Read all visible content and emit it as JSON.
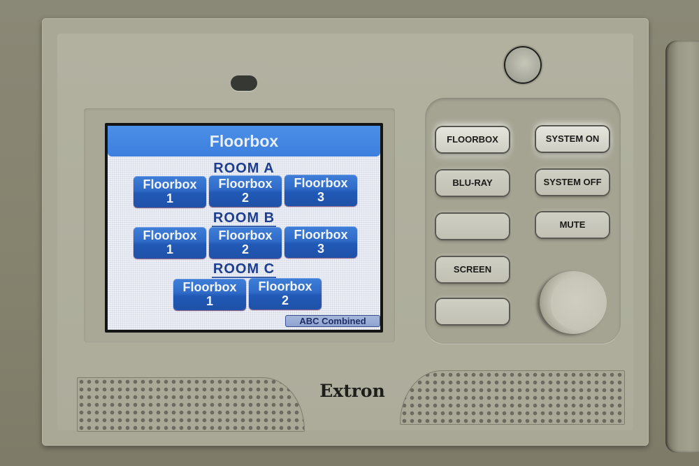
{
  "device": {
    "brand": "Extron",
    "colors": {
      "header_blue": "#3c7fdd",
      "button_blue": "#2f6ac7",
      "room_title_navy": "#1d3e8e",
      "panel_beige": "#adac9b"
    }
  },
  "screen": {
    "header": {
      "title": "Floorbox"
    },
    "rooms": [
      {
        "title": "ROOM A",
        "buttons": [
          {
            "label": "Floorbox",
            "number": "1"
          },
          {
            "label": "Floorbox",
            "number": "2"
          },
          {
            "label": "Floorbox",
            "number": "3"
          }
        ]
      },
      {
        "title": "ROOM B",
        "buttons": [
          {
            "label": "Floorbox",
            "number": "1"
          },
          {
            "label": "Floorbox",
            "number": "2"
          },
          {
            "label": "Floorbox",
            "number": "3"
          }
        ]
      },
      {
        "title": "ROOM C",
        "buttons": [
          {
            "label": "Floorbox",
            "number": "1"
          },
          {
            "label": "Floorbox",
            "number": "2"
          }
        ]
      }
    ],
    "combined_button": {
      "label": "ABC Combined"
    }
  },
  "hard_buttons": {
    "left": [
      {
        "label": "FLOORBOX",
        "lit": true
      },
      {
        "label": "BLU-RAY",
        "lit": false
      },
      {
        "label": "",
        "lit": false
      },
      {
        "label": "SCREEN",
        "lit": false
      },
      {
        "label": "",
        "lit": false
      }
    ],
    "right": [
      {
        "label": "SYSTEM ON",
        "lit": true
      },
      {
        "label": "SYSTEM OFF",
        "lit": false
      },
      {
        "label": "MUTE",
        "lit": false
      }
    ]
  },
  "icons": {
    "volume_knob": "volume-knob-icon",
    "light_sensor": "light-sensor-icon",
    "proximity_sensor": "proximity-sensor-icon",
    "speaker": "speaker-grille-icon"
  }
}
